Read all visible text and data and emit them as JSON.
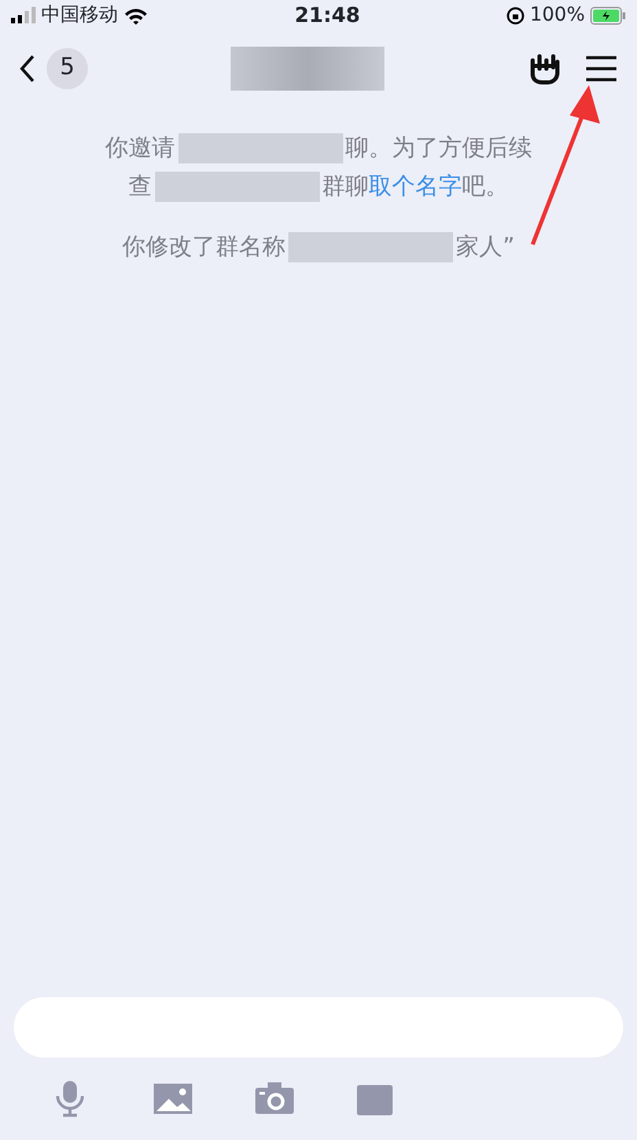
{
  "status_bar": {
    "carrier": "中国移动",
    "time": "21:48",
    "battery": "100%"
  },
  "nav": {
    "back_badge": "5"
  },
  "messages": [
    {
      "lines": [
        [
          {
            "kind": "text",
            "text": "你邀请"
          },
          {
            "kind": "redacted"
          },
          {
            "kind": "text",
            "text": "聊。为了方便后续"
          }
        ],
        [
          {
            "kind": "text",
            "text": "查"
          },
          {
            "kind": "redacted"
          },
          {
            "kind": "text",
            "text": "群聊"
          },
          {
            "kind": "link",
            "text": "取个名字"
          },
          {
            "kind": "text",
            "text": "吧。"
          }
        ]
      ]
    },
    {
      "lines": [
        [
          {
            "kind": "text",
            "text": "你修改了群名称"
          },
          {
            "kind": "redacted"
          },
          {
            "kind": "text",
            "text": "家人”"
          }
        ]
      ]
    }
  ],
  "toolbar": [
    {
      "kind": "mic"
    },
    {
      "kind": "image"
    },
    {
      "kind": "camera"
    },
    {
      "kind": "box"
    }
  ]
}
